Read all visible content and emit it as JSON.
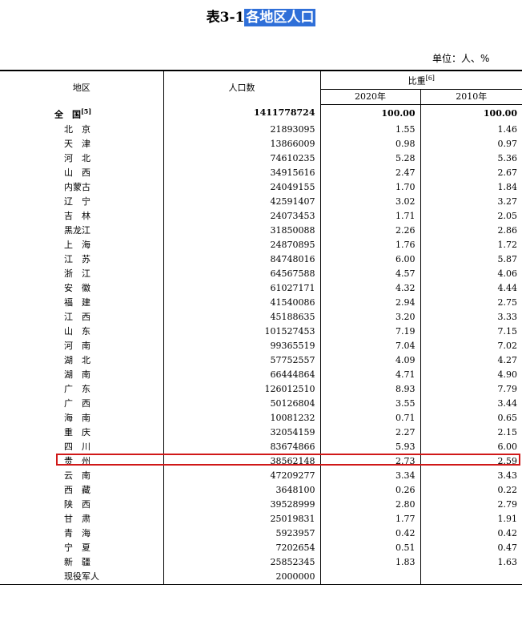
{
  "title": {
    "prefix": "表3-1",
    "highlighted": "各地区人口"
  },
  "unit": "单位：人、%",
  "headers": {
    "region": "地区",
    "population": "人口数",
    "share": "比重",
    "share_note": "[6]",
    "year_2020": "2020年",
    "year_2010": "2010年"
  },
  "total": {
    "name": "全　国",
    "note": "[5]",
    "population": "1411778724",
    "y2020": "100.00",
    "y2010": "100.00"
  },
  "rows": [
    {
      "name": "北　京",
      "population": "21893095",
      "y2020": "1.55",
      "y2010": "1.46"
    },
    {
      "name": "天　津",
      "population": "13866009",
      "y2020": "0.98",
      "y2010": "0.97"
    },
    {
      "name": "河　北",
      "population": "74610235",
      "y2020": "5.28",
      "y2010": "5.36"
    },
    {
      "name": "山　西",
      "population": "34915616",
      "y2020": "2.47",
      "y2010": "2.67"
    },
    {
      "name": "内蒙古",
      "population": "24049155",
      "y2020": "1.70",
      "y2010": "1.84"
    },
    {
      "name": "辽　宁",
      "population": "42591407",
      "y2020": "3.02",
      "y2010": "3.27"
    },
    {
      "name": "吉　林",
      "population": "24073453",
      "y2020": "1.71",
      "y2010": "2.05"
    },
    {
      "name": "黑龙江",
      "population": "31850088",
      "y2020": "2.26",
      "y2010": "2.86"
    },
    {
      "name": "上　海",
      "population": "24870895",
      "y2020": "1.76",
      "y2010": "1.72"
    },
    {
      "name": "江　苏",
      "population": "84748016",
      "y2020": "6.00",
      "y2010": "5.87"
    },
    {
      "name": "浙　江",
      "population": "64567588",
      "y2020": "4.57",
      "y2010": "4.06"
    },
    {
      "name": "安　徽",
      "population": "61027171",
      "y2020": "4.32",
      "y2010": "4.44"
    },
    {
      "name": "福　建",
      "population": "41540086",
      "y2020": "2.94",
      "y2010": "2.75"
    },
    {
      "name": "江　西",
      "population": "45188635",
      "y2020": "3.20",
      "y2010": "3.33"
    },
    {
      "name": "山　东",
      "population": "101527453",
      "y2020": "7.19",
      "y2010": "7.15"
    },
    {
      "name": "河　南",
      "population": "99365519",
      "y2020": "7.04",
      "y2010": "7.02"
    },
    {
      "name": "湖　北",
      "population": "57752557",
      "y2020": "4.09",
      "y2010": "4.27"
    },
    {
      "name": "湖　南",
      "population": "66444864",
      "y2020": "4.71",
      "y2010": "4.90"
    },
    {
      "name": "广　东",
      "population": "126012510",
      "y2020": "8.93",
      "y2010": "7.79"
    },
    {
      "name": "广　西",
      "population": "50126804",
      "y2020": "3.55",
      "y2010": "3.44"
    },
    {
      "name": "海　南",
      "population": "10081232",
      "y2020": "0.71",
      "y2010": "0.65"
    },
    {
      "name": "重　庆",
      "population": "32054159",
      "y2020": "2.27",
      "y2010": "2.15"
    },
    {
      "name": "四　川",
      "population": "83674866",
      "y2020": "5.93",
      "y2010": "6.00"
    },
    {
      "name": "贵　州",
      "population": "38562148",
      "y2020": "2.73",
      "y2010": "2.59"
    },
    {
      "name": "云　南",
      "population": "47209277",
      "y2020": "3.34",
      "y2010": "3.43"
    },
    {
      "name": "西　藏",
      "population": "3648100",
      "y2020": "0.26",
      "y2010": "0.22"
    },
    {
      "name": "陕　西",
      "population": "39528999",
      "y2020": "2.80",
      "y2010": "2.79"
    },
    {
      "name": "甘　肃",
      "population": "25019831",
      "y2020": "1.77",
      "y2010": "1.91"
    },
    {
      "name": "青　海",
      "population": "5923957",
      "y2020": "0.42",
      "y2010": "0.42"
    },
    {
      "name": "宁　夏",
      "population": "7202654",
      "y2020": "0.51",
      "y2010": "0.47"
    },
    {
      "name": "新　疆",
      "population": "25852345",
      "y2020": "1.83",
      "y2010": "1.63"
    },
    {
      "name": "现役军人",
      "population": "2000000",
      "y2020": "",
      "y2010": ""
    }
  ],
  "highlight_color": "#d01818",
  "selection_color": "#2f6fd8"
}
